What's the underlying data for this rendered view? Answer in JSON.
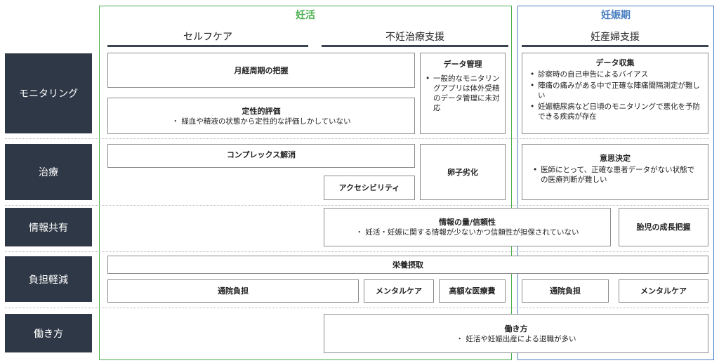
{
  "phases": {
    "ninkatsu": {
      "title": "妊活",
      "color": "#4caf50"
    },
    "ninshin": {
      "title": "妊娠期",
      "color": "#4a7fc1"
    }
  },
  "columns": {
    "selfcare": "セルフケア",
    "funin": "不妊治療支援",
    "ninsanpu": "妊産婦支援"
  },
  "rows": {
    "monitoring": "モニタリング",
    "chiryo": "治療",
    "joho": "情報共有",
    "futan": "負担軽減",
    "hataraki": "働き方"
  },
  "boxes": {
    "gekkei": {
      "title": "月経周期の把握"
    },
    "teisei": {
      "title": "定性的評価",
      "line": "・ 経血や精液の状態から定性的な評価しかしていない"
    },
    "data_kanri": {
      "title": "データ管理",
      "bullet": "一般的なモニタリングアプリは体外受精のデータ管理に未対応"
    },
    "data_shushu": {
      "title": "データ収集",
      "bullets": [
        "診察時の自己申告によるバイアス",
        "陣痛の痛みがある中で正確な陣痛間隔測定が難しい",
        "妊娠糖尿病など日頃のモニタリングで悪化を予防できる疾病が存在"
      ]
    },
    "complex": {
      "title": "コンプレックス解消"
    },
    "ranshi": {
      "title": "卵子劣化"
    },
    "access": {
      "title": "アクセシビリティ"
    },
    "ishi": {
      "title": "意思決定",
      "bullet": "医師にとって、正確な患者データがない状態での医療判断が難しい"
    },
    "joho_ryo": {
      "title": "情報の量/信頼性",
      "line": "・ 妊活・妊娠に関する情報が少ないかつ信頼性が担保されていない"
    },
    "taiji": {
      "title": "胎児の成長把握"
    },
    "eiyo": {
      "title": "栄養摂取"
    },
    "tsuin1": {
      "title": "通院負担"
    },
    "mental1": {
      "title": "メンタルケア"
    },
    "kogaku": {
      "title": "高額な医療費"
    },
    "tsuin2": {
      "title": "通院負担"
    },
    "mental2": {
      "title": "メンタルケア"
    },
    "hataraki": {
      "title": "働き方",
      "line": "・ 妊活や妊娠出産による退職が多い"
    }
  }
}
